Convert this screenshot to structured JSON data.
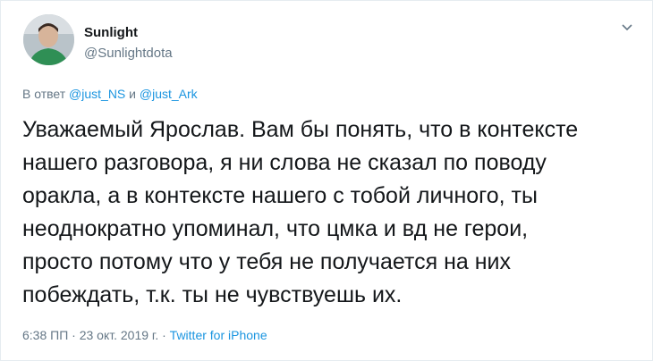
{
  "tweet": {
    "author_name": "Sunlight",
    "author_handle": "@Sunlightdota",
    "reply_prefix": "В ответ",
    "reply_to_1": "@just_NS",
    "reply_joiner": "и",
    "reply_to_2": "@just_Ark",
    "text": "Уважаемый Ярослав. Вам бы понять, что в контексте\nнашего разговора, я ни слова не сказал по поводу\nоракла, а в контексте нашего с тобой личного, ты\nнеоднократно упоминал, что цмка и вд не герои,\nпросто потому что у тебя не получается на них\nпобеждать, т.к. ты не чувствуешь их.",
    "time": "6:38 ПП",
    "separator": "·",
    "date": "23 окт. 2019 г.",
    "source": "Twitter for iPhone"
  },
  "icons": {
    "caret": "chevron-down-icon",
    "avatar": "avatar"
  },
  "colors": {
    "link": "#1b95e0",
    "muted": "#657786",
    "text": "#14171a"
  }
}
